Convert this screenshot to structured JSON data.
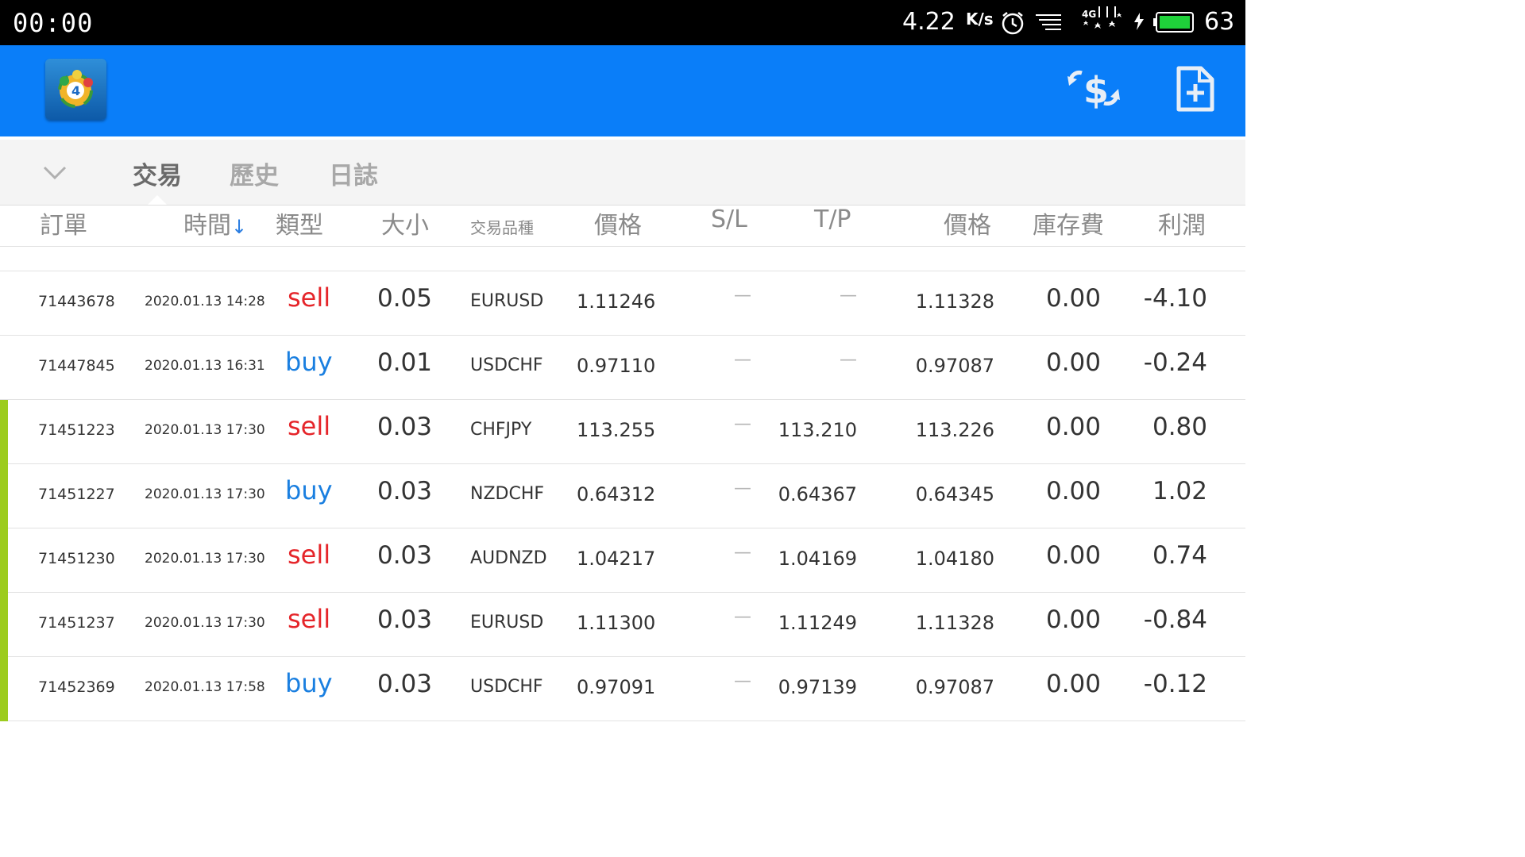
{
  "status_bar": {
    "time": "00:00",
    "net_speed": "4.22",
    "net_speed_unit": "K/s",
    "network_type": "4G",
    "battery_level": "63",
    "icons": [
      "alarm-icon",
      "signal-lines-icon",
      "cellular-4g-icon",
      "charging-icon",
      "battery-icon"
    ]
  },
  "app_bar": {
    "logo_icon": "metatrader4-logo",
    "actions": [
      {
        "name": "currency-exchange-icon"
      },
      {
        "name": "new-order-icon"
      }
    ],
    "color": "#0a7ef9"
  },
  "tabs": {
    "collapse_icon": "chevron-down-icon",
    "items": [
      {
        "label": "交易",
        "active": true
      },
      {
        "label": "歷史",
        "active": false
      },
      {
        "label": "日誌",
        "active": false
      }
    ]
  },
  "table": {
    "headers": {
      "order": "訂單",
      "time": "時間",
      "type": "類型",
      "size": "大小",
      "symbol": "交易品種",
      "price": "價格",
      "sl": "S/L",
      "tp": "T/P",
      "current_price": "價格",
      "swap": "庫存費",
      "profit": "利潤"
    },
    "sort_icon": "arrow-down-icon",
    "rows": [
      {
        "order": "71443678",
        "time": "2020.01.13 14:28",
        "type": "sell",
        "size": "0.05",
        "symbol": "EURUSD",
        "price": "1.11246",
        "sl": "—",
        "tp": "—",
        "current_price": "1.11328",
        "swap": "0.00",
        "profit": "-4.10",
        "marked": false
      },
      {
        "order": "71447845",
        "time": "2020.01.13 16:31",
        "type": "buy",
        "size": "0.01",
        "symbol": "USDCHF",
        "price": "0.97110",
        "sl": "—",
        "tp": "—",
        "current_price": "0.97087",
        "swap": "0.00",
        "profit": "-0.24",
        "marked": false
      },
      {
        "order": "71451223",
        "time": "2020.01.13 17:30",
        "type": "sell",
        "size": "0.03",
        "symbol": "CHFJPY",
        "price": "113.255",
        "sl": "—",
        "tp": "113.210",
        "current_price": "113.226",
        "swap": "0.00",
        "profit": "0.80",
        "marked": true
      },
      {
        "order": "71451227",
        "time": "2020.01.13 17:30",
        "type": "buy",
        "size": "0.03",
        "symbol": "NZDCHF",
        "price": "0.64312",
        "sl": "—",
        "tp": "0.64367",
        "current_price": "0.64345",
        "swap": "0.00",
        "profit": "1.02",
        "marked": true
      },
      {
        "order": "71451230",
        "time": "2020.01.13 17:30",
        "type": "sell",
        "size": "0.03",
        "symbol": "AUDNZD",
        "price": "1.04217",
        "sl": "—",
        "tp": "1.04169",
        "current_price": "1.04180",
        "swap": "0.00",
        "profit": "0.74",
        "marked": true
      },
      {
        "order": "71451237",
        "time": "2020.01.13 17:30",
        "type": "sell",
        "size": "0.03",
        "symbol": "EURUSD",
        "price": "1.11300",
        "sl": "—",
        "tp": "1.11249",
        "current_price": "1.11328",
        "swap": "0.00",
        "profit": "-0.84",
        "marked": true
      },
      {
        "order": "71452369",
        "time": "2020.01.13 17:58",
        "type": "buy",
        "size": "0.03",
        "symbol": "USDCHF",
        "price": "0.97091",
        "sl": "—",
        "tp": "0.97139",
        "current_price": "0.97087",
        "swap": "0.00",
        "profit": "-0.12",
        "marked": true
      }
    ],
    "colors": {
      "sell": "#e5252a",
      "buy": "#1a7fe0",
      "marker": "#9ccc1e"
    }
  }
}
